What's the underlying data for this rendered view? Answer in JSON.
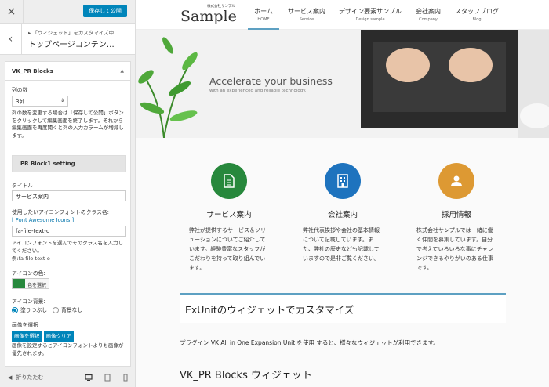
{
  "panel": {
    "close_icon": "×",
    "save_label": "保存して公開",
    "back_icon": "‹",
    "breadcrumb": "「ウィジェット」をカスタマイズ中",
    "title": "トップページコンテン…",
    "section_title": "VK_PR Blocks",
    "section_toggle": "▲",
    "cols_label": "列の数",
    "cols_value": "3列",
    "cols_desc": "列の数を変更する場合は「保存して公開」ボタンをクリックして編集画面を終了します。それから編集画面を再度開くと列の入力カラームが増減します。",
    "block_setting": "PR Block1 setting",
    "title_label": "タイトル",
    "title_value": "サービス案内",
    "icon_label": "使用したいアイコンフォントのクラス名:",
    "icon_link": "[ Font Awesome Icons ]",
    "icon_value": "fa-file-text-o",
    "icon_desc": "アイコンフォントを選んでそのクラス名を入力してください。",
    "icon_example": "例:fa-file-text-o",
    "color_label": "アイコンの色:",
    "color_btn": "色を選択",
    "icon_color": "#27883c",
    "bg_label": "アイコン背景:",
    "bg_opt1": "塗りつぶし",
    "bg_opt2": "背景なし",
    "img_label": "画像を選択",
    "img_select": "画像を選択",
    "img_clear": "画像クリア",
    "img_desc": "画像を設定するとアイコンフォントよりも画像が優先されます。",
    "collapse_label": "折りたたむ",
    "collapse_icon": "◀",
    "device_icons": [
      "desktop-icon",
      "tablet-icon",
      "mobile-icon"
    ]
  },
  "site": {
    "logo": "Sample",
    "logo_small": "株式会社サンプル",
    "nav": [
      {
        "label": "ホーム",
        "en": "HOME"
      },
      {
        "label": "サービス案内",
        "en": "Service"
      },
      {
        "label": "デザイン要素サンプル",
        "en": "Design sample"
      },
      {
        "label": "会社案内",
        "en": "Company"
      },
      {
        "label": "スタッフブログ",
        "en": "Blog"
      }
    ],
    "hero_title": "Accelerate your business",
    "hero_sub": "with an experienced and reliable technology.",
    "pr": [
      {
        "title": "サービス案内",
        "text": "弊社が提供するサービス＆ソリューションについてご紹介しています。経験豊富なスタッフがこだわりを持って取り組んでいます。",
        "color": "#27883c",
        "icon": "document-icon"
      },
      {
        "title": "会社案内",
        "text": "弊社代表挨拶や会社の基本情報について記載しています。また、弊社の歴史なども記載していますので是非ご覧ください。",
        "color": "#1e73be",
        "icon": "building-icon"
      },
      {
        "title": "採用情報",
        "text": "株式会社サンプルでは一緒に働く仲間を募集しています。自分で考えていろいろな事にチャレンジできるやりがいのある仕事です。",
        "color": "#dd9933",
        "icon": "user-icon"
      }
    ],
    "exunit_title": "ExUnitのウィジェットでカスタマイズ",
    "exunit_desc": "プラグイン VK All in One Expansion Unit を使用 すると、様々なウィジェットが利用できます。",
    "vk_heading": "VK_PR Blocks ウィジェット"
  }
}
